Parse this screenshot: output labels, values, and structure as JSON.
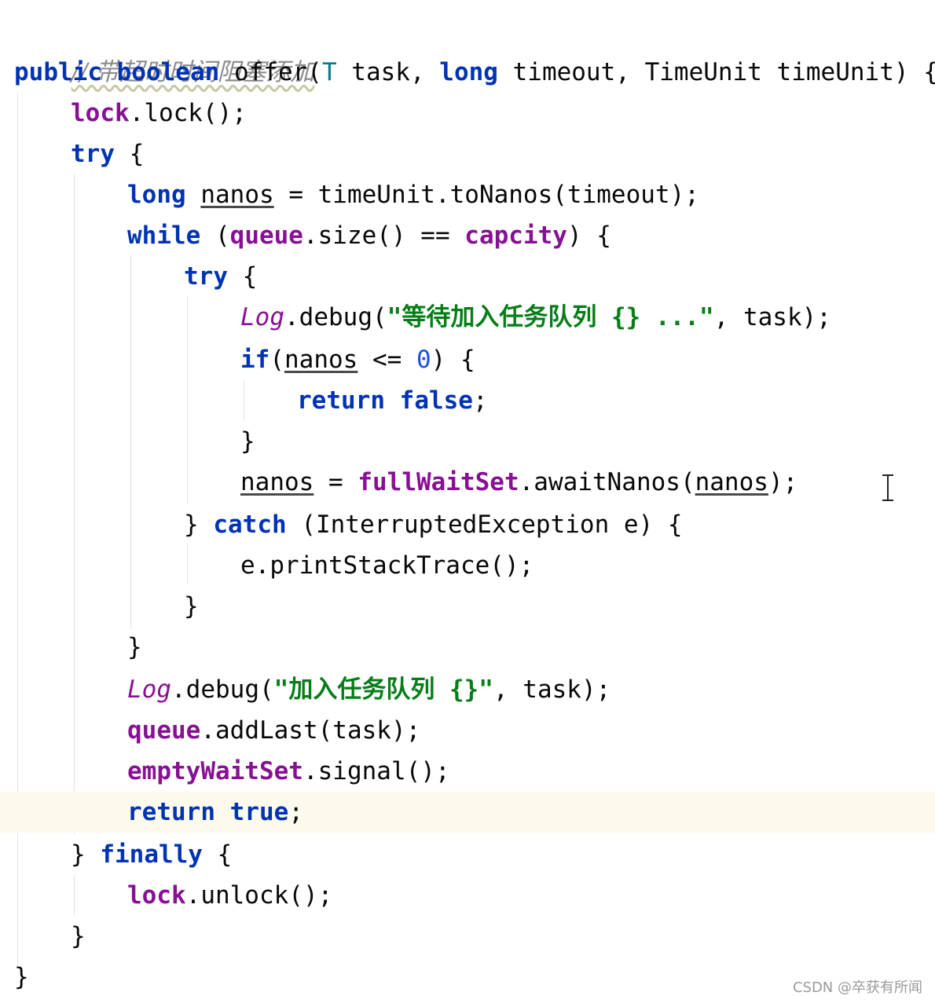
{
  "editor": {
    "comment": "// 带超时时间阻塞添加",
    "signature": {
      "public": "public",
      "boolean": "boolean",
      "name": "offer(",
      "type_t": "T",
      "p1": " task, ",
      "long": "long",
      "p2": " timeout, TimeUnit timeUnit) {"
    },
    "l_lock": {
      "field": "lock",
      "rest": ".lock();"
    },
    "l_try1": {
      "kw": "try",
      "rest": " {"
    },
    "l_nanos": {
      "long": "long",
      "var": "nanos",
      "rest": " = timeUnit.toNanos(timeout);"
    },
    "l_while": {
      "kw": "while",
      "p1": " (",
      "queue": "queue",
      "p2": ".size() == ",
      "capcity": "capcity",
      "p3": ") {"
    },
    "l_try2": {
      "kw": "try",
      "rest": " {"
    },
    "l_log1": {
      "log": "Log",
      "p1": ".debug(",
      "str": "\"等待加入任务队列 {} ...\"",
      "p2": ", task);"
    },
    "l_if": {
      "kw": "if",
      "p1": "(",
      "var": "nanos",
      "p2": " <= ",
      "num": "0",
      "p3": ") {"
    },
    "l_return_false": {
      "kw1": "return",
      "sp": " ",
      "kw2": "false",
      "rest": ";"
    },
    "l_close1": "}",
    "l_await": {
      "var": "nanos",
      "p1": " = ",
      "field": "fullWaitSet",
      "p2": ".awaitNanos(",
      "var2": "nanos",
      "p3": ");"
    },
    "l_catch": {
      "p1": "} ",
      "kw": "catch",
      "p2": " (InterruptedException e) {"
    },
    "l_print": "e.printStackTrace();",
    "l_close2": "}",
    "l_close3": "}",
    "l_log2": {
      "log": "Log",
      "p1": ".debug(",
      "str": "\"加入任务队列 {}\"",
      "p2": ", task);"
    },
    "l_addlast": {
      "field": "queue",
      "rest": ".addLast(task);"
    },
    "l_signal": {
      "field": "emptyWaitSet",
      "rest": ".signal();"
    },
    "l_return_true": {
      "kw1": "return",
      "sp": " ",
      "kw2": "true",
      "rest": ";"
    },
    "l_finally": {
      "p1": "} ",
      "kw": "finally",
      "p2": " {"
    },
    "l_unlock": {
      "field": "lock",
      "rest": ".unlock();"
    },
    "l_close4": "}",
    "l_close5": "}"
  },
  "watermark": "CSDN @卒获有所闻"
}
